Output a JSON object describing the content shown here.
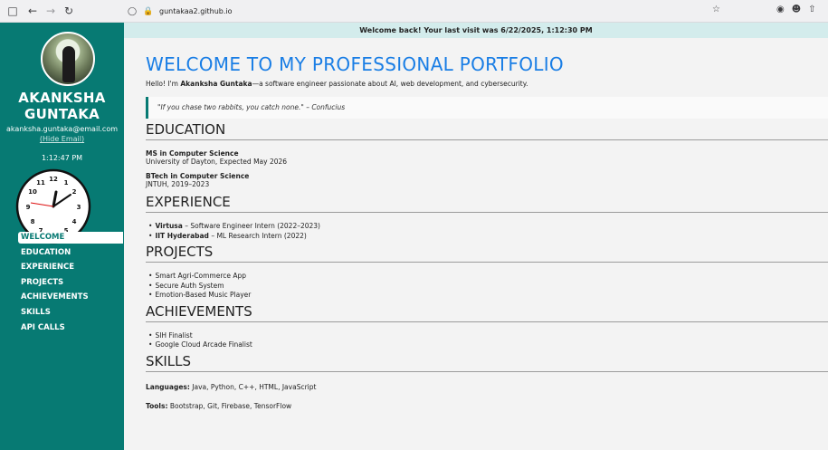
{
  "browser": {
    "url": "guntakaa2.github.io"
  },
  "sidebar": {
    "name_line1": "AKANKSHA",
    "name_line2": "GUNTAKA",
    "email": "akanksha.guntaka@email.com",
    "hide_email": "(Hide Email)",
    "time": "1:12:47 PM",
    "nav": [
      {
        "label": "WELCOME",
        "active": true
      },
      {
        "label": "EDUCATION"
      },
      {
        "label": "EXPERIENCE"
      },
      {
        "label": "PROJECTS"
      },
      {
        "label": "ACHIEVEMENTS"
      },
      {
        "label": "SKILLS"
      },
      {
        "label": "API CALLS"
      }
    ]
  },
  "main": {
    "welcome_bar": "Welcome back! Your last visit was 6/22/2025, 1:12:30 PM",
    "title": "WELCOME TO MY PROFESSIONAL PORTFOLIO",
    "intro_pre": "Hello! I'm ",
    "intro_name": "Akanksha Guntaka",
    "intro_post": "—a software engineer passionate about AI, web development, and cybersecurity.",
    "quote": "\"If you chase two rabbits, you catch none.\" – Confucius",
    "education": {
      "heading": "EDUCATION",
      "items": [
        {
          "title": "MS in Computer Science",
          "sub": "University of Dayton, Expected May 2026"
        },
        {
          "title": "BTech in Computer Science",
          "sub": "JNTUH, 2019–2023"
        }
      ]
    },
    "experience": {
      "heading": "EXPERIENCE",
      "items": [
        {
          "org": "Virtusa",
          "role": " – Software Engineer Intern (2022–2023)"
        },
        {
          "org": "IIT Hyderabad",
          "role": " – ML Research Intern (2022)"
        }
      ]
    },
    "projects": {
      "heading": "PROJECTS",
      "items": [
        "Smart Agri-Commerce App",
        "Secure Auth System",
        "Emotion-Based Music Player"
      ]
    },
    "achievements": {
      "heading": "ACHIEVEMENTS",
      "items": [
        "SIH Finalist",
        "Google Cloud Arcade Finalist"
      ]
    },
    "skills": {
      "heading": "SKILLS",
      "languages_label": "Languages:",
      "languages": " Java, Python, C++, HTML, JavaScript",
      "tools_label": "Tools:",
      "tools": " Bootstrap, Git, Firebase, TensorFlow"
    }
  }
}
